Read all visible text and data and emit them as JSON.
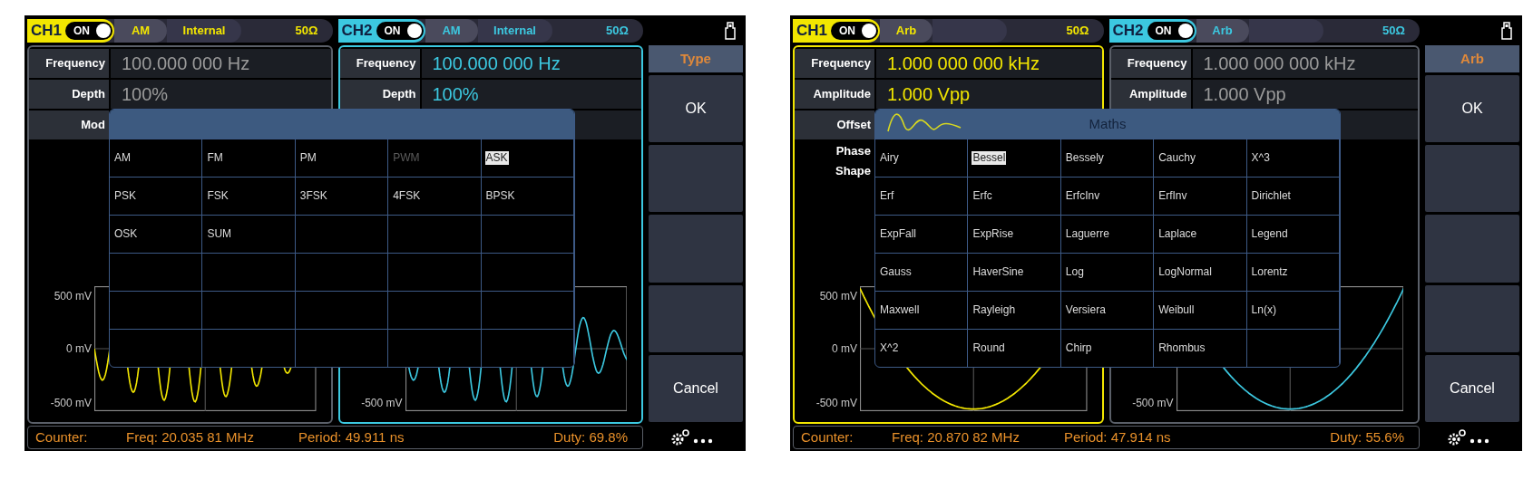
{
  "screens": [
    {
      "channels": [
        {
          "name": "CH1",
          "color": "#f2e600",
          "selected": false,
          "on": true,
          "toggle_label": "ON",
          "mode": "AM",
          "source": "Internal",
          "impedance": "50Ω",
          "params": [
            {
              "kind": "row",
              "label": "Frequency",
              "value": "100.000 000 Hz"
            },
            {
              "kind": "row",
              "label": "Depth",
              "value": "100%"
            },
            {
              "kind": "row",
              "label": "Mod"
            }
          ],
          "plot": {
            "kind": "am",
            "y_labels": [
              {
                "kind": "top",
                "text": "500 mV"
              },
              {
                "kind": "middle",
                "text": "0 mV"
              },
              {
                "kind": "bottom",
                "text": "-500 mV"
              }
            ]
          }
        },
        {
          "name": "CH2",
          "color": "#3cc8e0",
          "selected": true,
          "on": true,
          "toggle_label": "ON",
          "mode": "AM",
          "source": "Internal",
          "impedance": "50Ω",
          "params": [
            {
              "kind": "row",
              "label": "Frequency",
              "value": "100.000 000 Hz"
            },
            {
              "kind": "row",
              "label": "Depth",
              "value": "100%"
            },
            {
              "kind": "row"
            }
          ],
          "plot": {
            "kind": "am",
            "y_labels": [
              {
                "kind": "bottom",
                "text": "-500 mV"
              }
            ]
          }
        }
      ],
      "dialog": {
        "wave_icon": false,
        "items": [
          {
            "label": "AM",
            "selected": false,
            "disabled": false
          },
          {
            "label": "FM",
            "selected": false,
            "disabled": false
          },
          {
            "label": "PM",
            "selected": false,
            "disabled": false
          },
          {
            "label": "PWM",
            "selected": false,
            "disabled": true
          },
          {
            "label": "ASK",
            "selected": true,
            "disabled": false
          },
          {
            "label": "PSK",
            "selected": false,
            "disabled": false
          },
          {
            "label": "FSK",
            "selected": false,
            "disabled": false
          },
          {
            "label": "3FSK",
            "selected": false,
            "disabled": false
          },
          {
            "label": "4FSK",
            "selected": false,
            "disabled": false
          },
          {
            "label": "BPSK",
            "selected": false,
            "disabled": false
          },
          {
            "label": "OSK",
            "selected": false,
            "disabled": false
          },
          {
            "label": "SUM",
            "selected": false,
            "disabled": false
          }
        ]
      },
      "menu": [
        {
          "kind": "header",
          "label": "Type"
        },
        {
          "kind": "button",
          "label": "OK"
        },
        {
          "kind": "button"
        },
        {
          "kind": "button"
        },
        {
          "kind": "button"
        },
        {
          "kind": "button",
          "label": "Cancel"
        }
      ],
      "counter": {
        "label": "Counter:",
        "freq": "Freq: 20.035 81 MHz",
        "period": "Period: 49.911 ns",
        "duty": "Duty: 69.8%"
      }
    },
    {
      "channels": [
        {
          "name": "CH1",
          "color": "#f2e600",
          "selected": true,
          "on": true,
          "toggle_label": "ON",
          "mode": "Arb",
          "impedance": "50Ω",
          "params": [
            {
              "kind": "row",
              "label": "Frequency",
              "value": "1.000 000 000 kHz"
            },
            {
              "kind": "row",
              "label": "Amplitude",
              "value": "1.000 Vpp"
            },
            {
              "kind": "row",
              "label": "Offset"
            },
            {
              "kind": "plain",
              "label": "Phase"
            },
            {
              "kind": "plain",
              "label": "Shape"
            }
          ],
          "plot": {
            "kind": "parabola",
            "y_labels": [
              {
                "kind": "top",
                "text": "500 mV"
              },
              {
                "kind": "middle",
                "text": "0 mV"
              },
              {
                "kind": "bottom",
                "text": "-500 mV"
              }
            ]
          }
        },
        {
          "name": "CH2",
          "color": "#3cc8e0",
          "selected": false,
          "on": true,
          "toggle_label": "ON",
          "mode": "Arb",
          "impedance": "50Ω",
          "params": [
            {
              "kind": "row",
              "label": "Frequency",
              "value": "1.000 000 000 kHz"
            },
            {
              "kind": "row",
              "label": "Amplitude",
              "value": "1.000 Vpp"
            },
            {
              "kind": "row"
            }
          ],
          "plot": {
            "kind": "parabola",
            "y_labels": [
              {
                "kind": "bottom",
                "text": "-500 mV"
              }
            ]
          }
        }
      ],
      "dialog": {
        "title": "Maths",
        "wave_icon": true,
        "items": [
          {
            "label": "Airy",
            "selected": false,
            "disabled": false
          },
          {
            "label": "Bessel",
            "selected": true,
            "disabled": false
          },
          {
            "label": "Bessely",
            "selected": false,
            "disabled": false
          },
          {
            "label": "Cauchy",
            "selected": false,
            "disabled": false
          },
          {
            "label": "X^3",
            "selected": false,
            "disabled": false
          },
          {
            "label": "Erf",
            "selected": false,
            "disabled": false
          },
          {
            "label": "Erfc",
            "selected": false,
            "disabled": false
          },
          {
            "label": "ErfcInv",
            "selected": false,
            "disabled": false
          },
          {
            "label": "ErfInv",
            "selected": false,
            "disabled": false
          },
          {
            "label": "Dirichlet",
            "selected": false,
            "disabled": false
          },
          {
            "label": "ExpFall",
            "selected": false,
            "disabled": false
          },
          {
            "label": "ExpRise",
            "selected": false,
            "disabled": false
          },
          {
            "label": "Laguerre",
            "selected": false,
            "disabled": false
          },
          {
            "label": "Laplace",
            "selected": false,
            "disabled": false
          },
          {
            "label": "Legend",
            "selected": false,
            "disabled": false
          },
          {
            "label": "Gauss",
            "selected": false,
            "disabled": false
          },
          {
            "label": "HaverSine",
            "selected": false,
            "disabled": false
          },
          {
            "label": "Log",
            "selected": false,
            "disabled": false
          },
          {
            "label": "LogNormal",
            "selected": false,
            "disabled": false
          },
          {
            "label": "Lorentz",
            "selected": false,
            "disabled": false
          },
          {
            "label": "Maxwell",
            "selected": false,
            "disabled": false
          },
          {
            "label": "Rayleigh",
            "selected": false,
            "disabled": false
          },
          {
            "label": "Versiera",
            "selected": false,
            "disabled": false
          },
          {
            "label": "Weibull",
            "selected": false,
            "disabled": false
          },
          {
            "label": "Ln(x)",
            "selected": false,
            "disabled": false
          },
          {
            "label": "X^2",
            "selected": false,
            "disabled": false
          },
          {
            "label": "Round",
            "selected": false,
            "disabled": false
          },
          {
            "label": "Chirp",
            "selected": false,
            "disabled": false
          },
          {
            "label": "Rhombus",
            "selected": false,
            "disabled": false
          }
        ]
      },
      "menu": [
        {
          "kind": "header",
          "label": "Arb"
        },
        {
          "kind": "button",
          "label": "OK"
        },
        {
          "kind": "button"
        },
        {
          "kind": "button"
        },
        {
          "kind": "button"
        },
        {
          "kind": "button",
          "label": "Cancel"
        }
      ],
      "counter": {
        "label": "Counter:",
        "freq": "Freq: 20.870 82 MHz",
        "period": "Period: 47.914 ns",
        "duty": "Duty: 55.6%"
      }
    }
  ]
}
